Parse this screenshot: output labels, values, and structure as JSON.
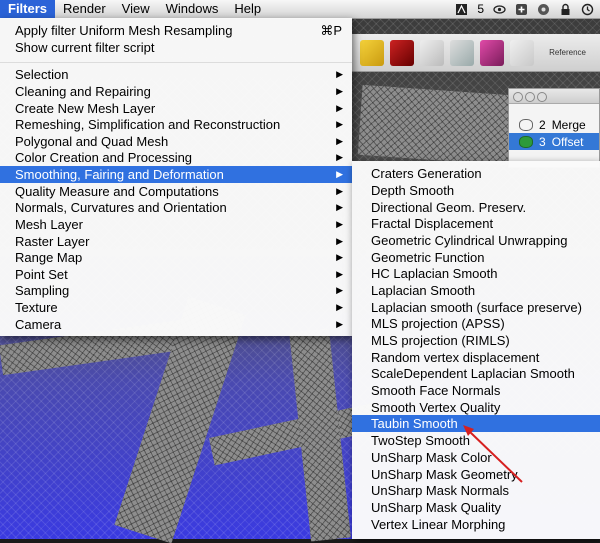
{
  "menubar": {
    "apple": "",
    "items": [
      "Filters",
      "Render",
      "View",
      "Windows",
      "Help"
    ],
    "status_text": "5"
  },
  "toolbar": {
    "label": "Reference"
  },
  "layers": [
    {
      "num": "2",
      "name": "Merge"
    },
    {
      "num": "3",
      "name": "Offset"
    }
  ],
  "filters_menu": {
    "apply_label": "Apply filter Uniform Mesh Resampling",
    "apply_shortcut": "⌘P",
    "show_script": "Show current filter script",
    "items": [
      "Selection",
      "Cleaning and Repairing",
      "Create New Mesh Layer",
      "Remeshing, Simplification and Reconstruction",
      "Polygonal and Quad Mesh",
      "Color Creation and Processing",
      "Smoothing, Fairing and Deformation",
      "Quality Measure and Computations",
      "Normals, Curvatures and Orientation",
      "Mesh Layer",
      "Raster Layer",
      "Range Map",
      "Point Set",
      "Sampling",
      "Texture",
      "Camera"
    ]
  },
  "submenu": {
    "items": [
      "Craters Generation",
      "Depth Smooth",
      "Directional Geom. Preserv.",
      "Fractal Displacement",
      "Geometric Cylindrical Unwrapping",
      "Geometric Function",
      "HC Laplacian Smooth",
      "Laplacian Smooth",
      "Laplacian smooth (surface preserve)",
      "MLS projection (APSS)",
      "MLS projection (RIMLS)",
      "Random vertex displacement",
      "ScaleDependent Laplacian Smooth",
      "Smooth Face Normals",
      "Smooth Vertex Quality",
      "Taubin Smooth",
      "TwoStep Smooth",
      "UnSharp Mask Color",
      "UnSharp Mask Geometry",
      "UnSharp Mask Normals",
      "UnSharp Mask Quality",
      "Vertex Linear Morphing"
    ]
  },
  "colors": {
    "highlight": "#3071e0",
    "menubar_active": "#2b63d8",
    "annotation_arrow": "#d62020"
  },
  "icons": {
    "status": [
      "adobe-icon",
      "eye-icon",
      "plus-icon",
      "network-icon",
      "lock-icon",
      "time-machine-icon"
    ]
  }
}
